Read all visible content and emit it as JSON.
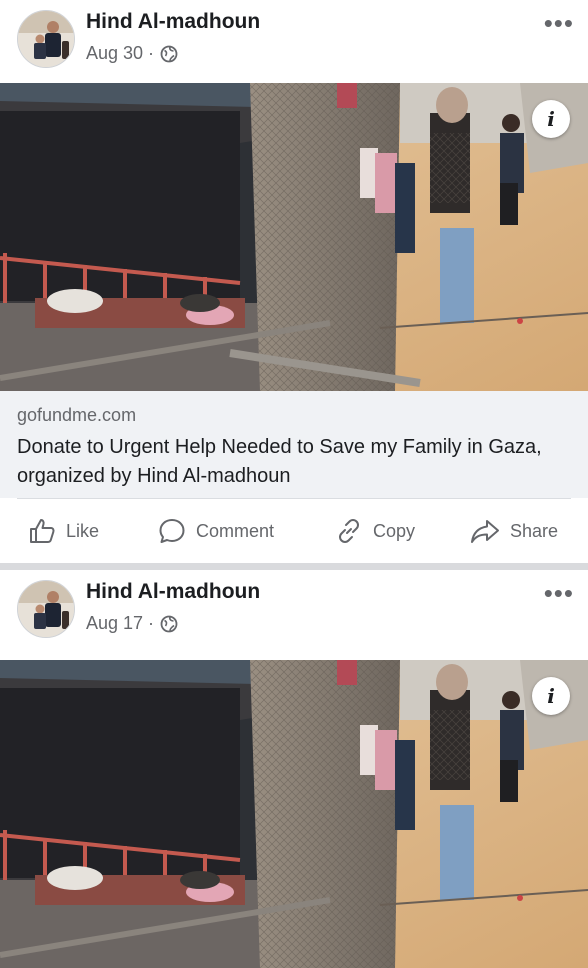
{
  "posts": [
    {
      "author": "Hind Al-madhoun",
      "date": "Aug 30 ·",
      "more": "•••",
      "info": "i",
      "link": {
        "domain": "gofundme.com",
        "title": "Donate to Urgent Help Needed to Save my Family in Gaza, organized by Hind Al-madhoun"
      },
      "actions": {
        "like": "Like",
        "comment": "Comment",
        "copy": "Copy",
        "share": "Share"
      }
    },
    {
      "author": "Hind Al-madhoun",
      "date": "Aug 17 ·",
      "more": "•••",
      "info": "i"
    }
  ],
  "icons": {
    "globe": "globe-icon",
    "more": "more-options-icon",
    "info": "info-icon",
    "like": "thumbs-up-icon",
    "comment": "comment-bubble-icon",
    "copy": "link-icon",
    "share": "share-arrow-icon"
  },
  "colors": {
    "secondary_text": "#65676b",
    "link_box_bg": "#f0f2f5",
    "divider": "#d9dadd"
  }
}
